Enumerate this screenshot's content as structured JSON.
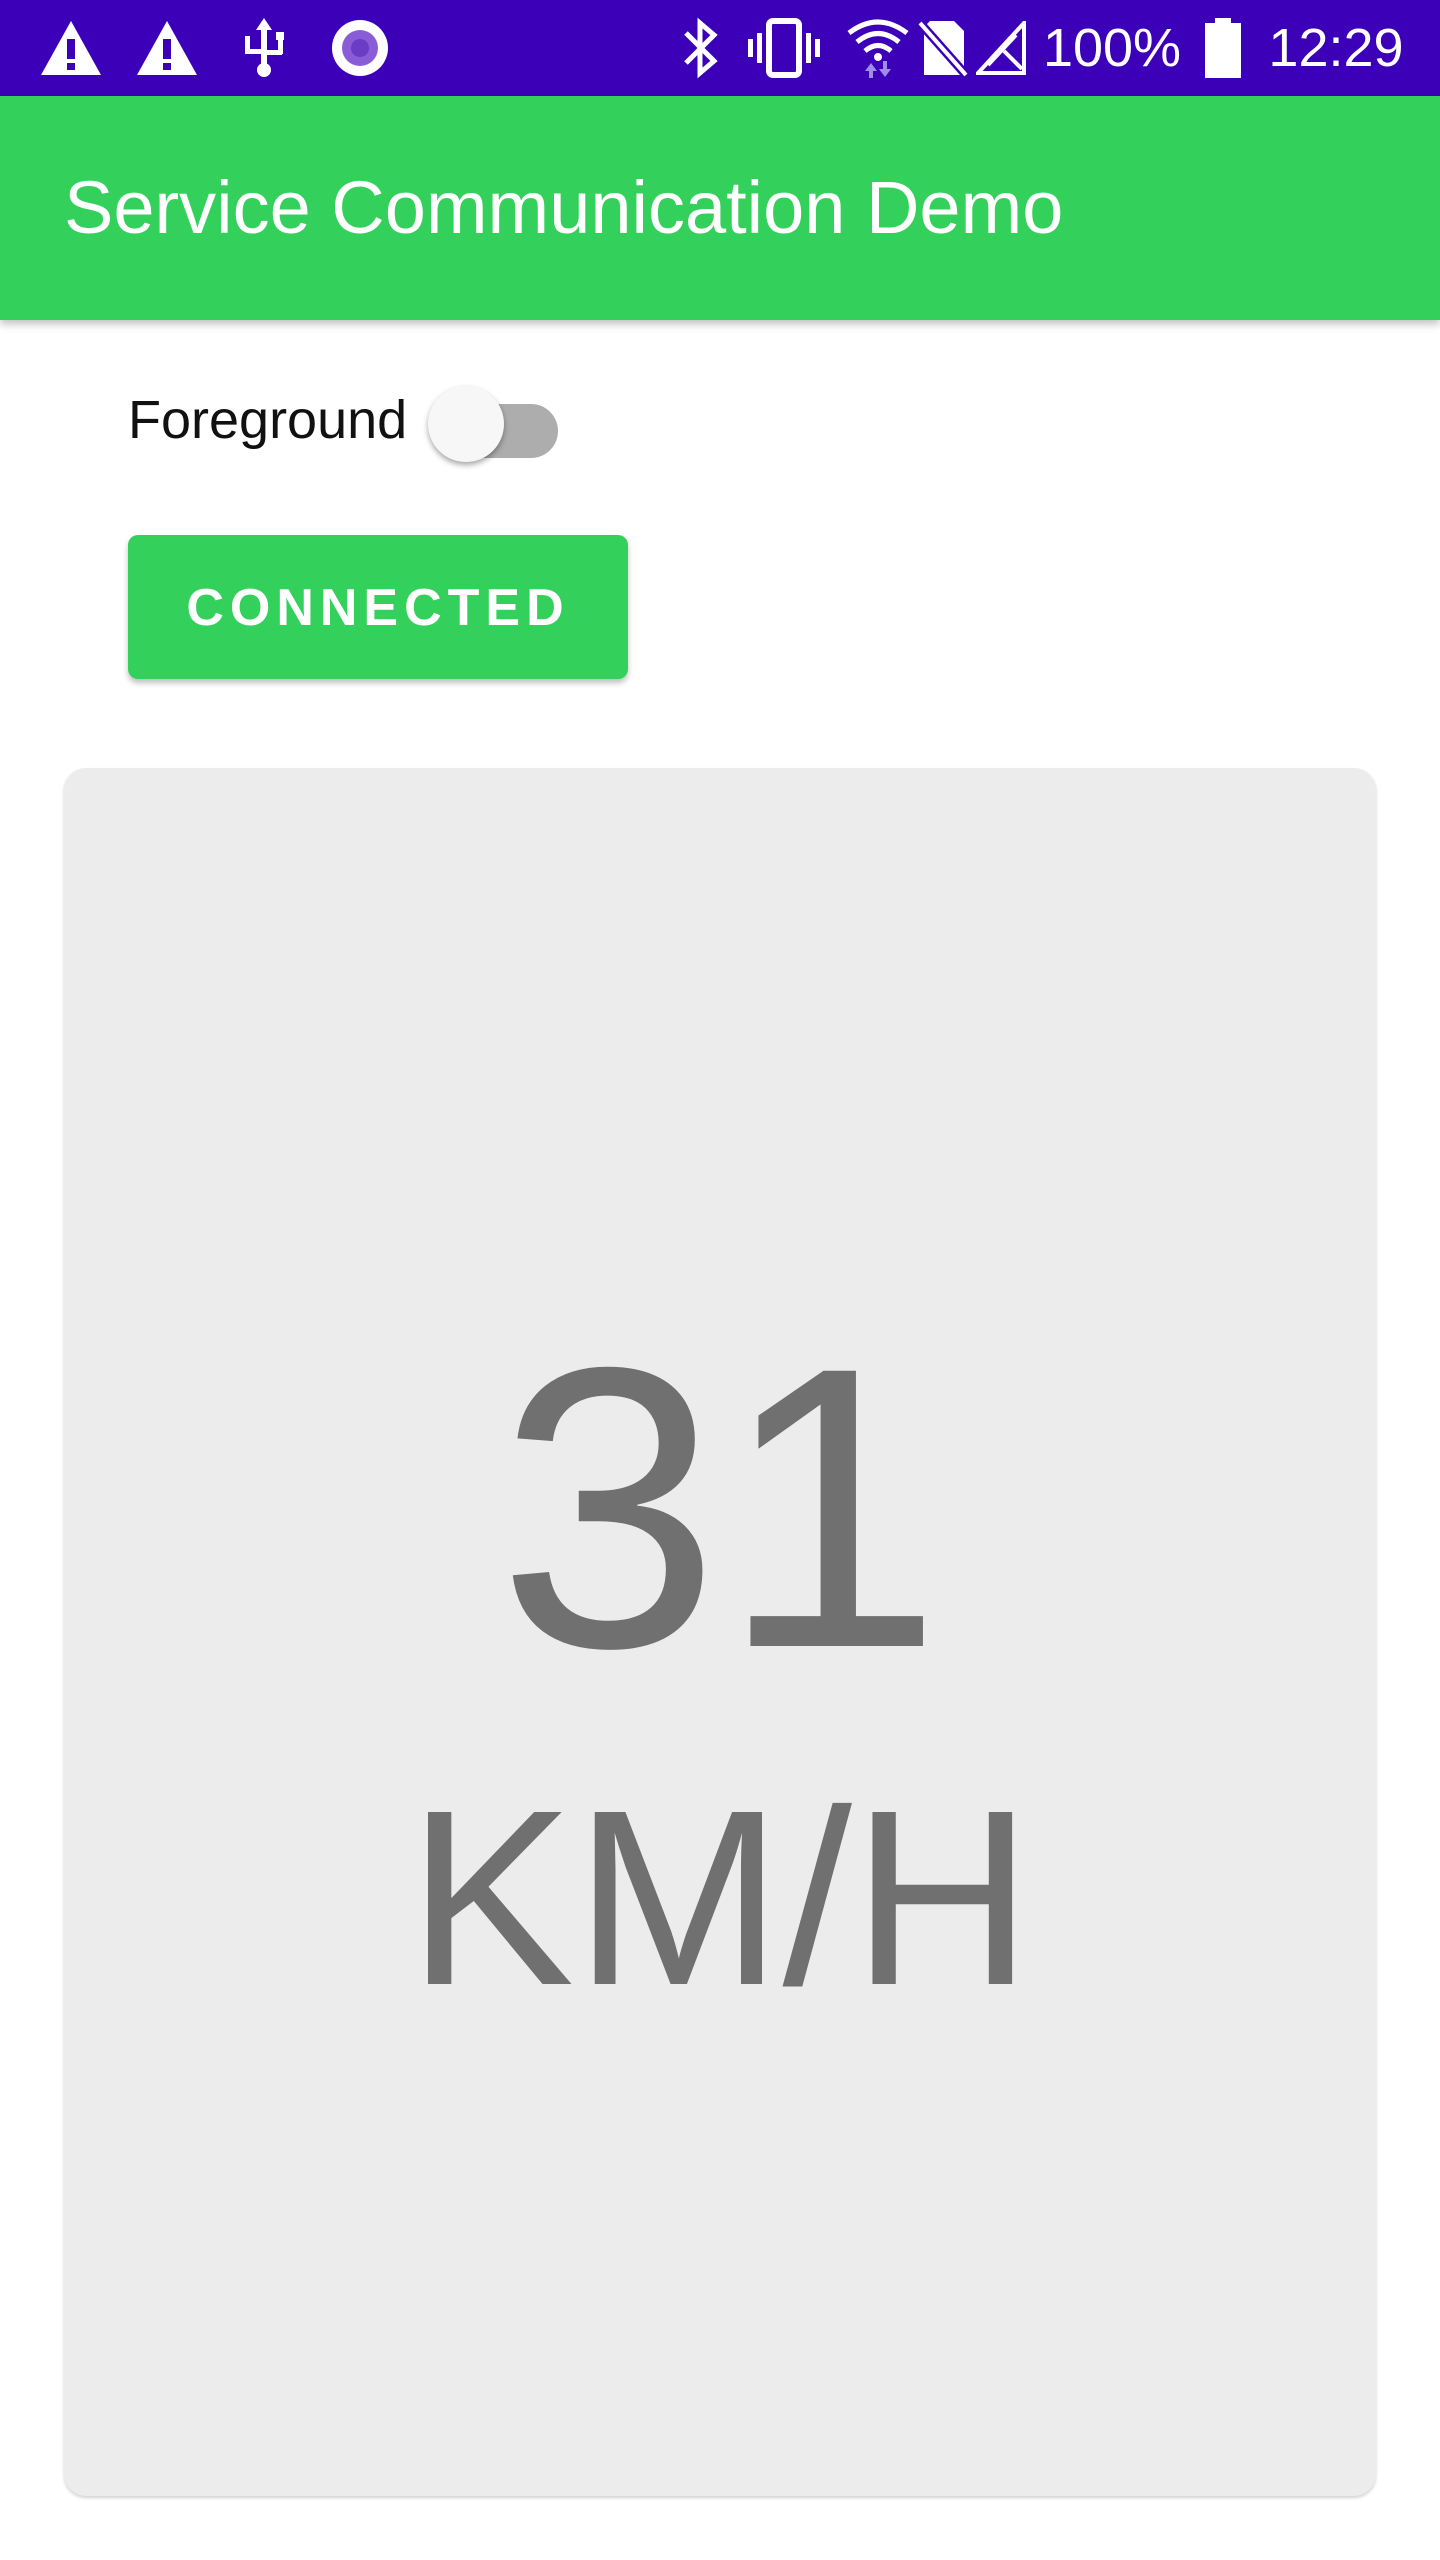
{
  "status_bar": {
    "icons": [
      "alert-icon",
      "alert-icon",
      "usb-icon",
      "record-icon",
      "bluetooth-icon",
      "vibrate-icon",
      "wifi-icon",
      "no-sim-icon",
      "no-signal-icon",
      "battery-icon"
    ],
    "battery_text": "100%",
    "time": "12:29",
    "background_color": "#3b00b8"
  },
  "app_bar": {
    "title": "Service Communication Demo",
    "background_color": "#33d15b"
  },
  "foreground_switch": {
    "label": "Foreground",
    "checked": false
  },
  "connection_button": {
    "label": "CONNECTED",
    "color": "#33d15b"
  },
  "speed_display": {
    "value": "31",
    "unit": "KM/H"
  }
}
